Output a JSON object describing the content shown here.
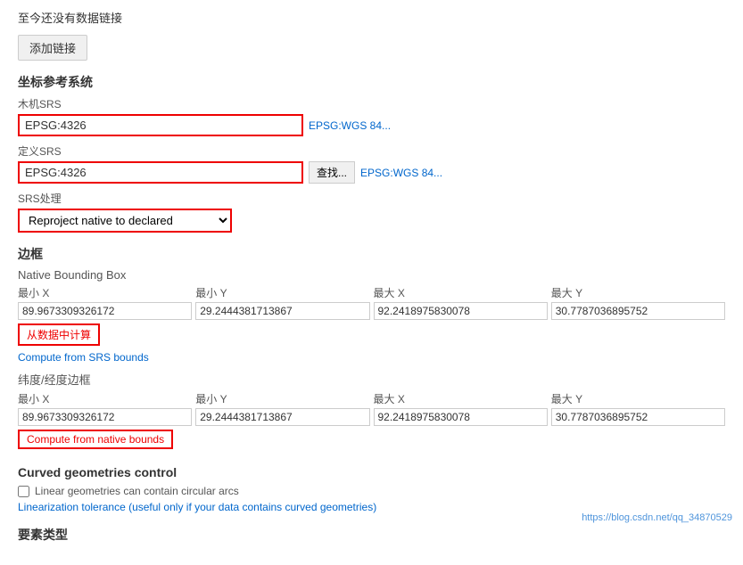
{
  "top": {
    "message": "至今还没有数据链接",
    "add_link_label": "添加链接"
  },
  "crs_section": {
    "title": "坐标参考系统",
    "native_srs_label": "木机SRS",
    "native_srs_value": "EPSG:4326",
    "native_srs_link": "EPSG:WGS 84...",
    "declared_srs_label": "定义SRS",
    "declared_srs_value": "EPSG:4326",
    "declared_srs_find": "查找...",
    "declared_srs_link": "EPSG:WGS 84...",
    "srs_handling_label": "SRS处理",
    "srs_handling_value": "Reproject native to declared ▼"
  },
  "bounding_box_section": {
    "title": "边框",
    "native_title": "Native Bounding Box",
    "col_labels": [
      "最小 X",
      "最小 Y",
      "最大 X",
      "最大 Y"
    ],
    "native_values": [
      "89.9673309326172",
      "29.2444381713867",
      "92.2418975830078",
      "30.7787036895752"
    ],
    "compute_native_btn": "从数据中计算",
    "compute_srs_link": "Compute from SRS bounds",
    "lat_lon_title": "纬度/经度边框",
    "lat_lon_values": [
      "89.9673309326172",
      "29.2444381713867",
      "92.2418975830078",
      "30.7787036895752"
    ],
    "compute_native_bounds_btn": "Compute from native bounds"
  },
  "curved_section": {
    "title": "Curved geometries control",
    "checkbox_label": "Linear geometries can contain circular arcs",
    "linearization_label": "Linearization tolerance (useful only if your data contains curved geometries)"
  },
  "feature_type_section": {
    "title": "要素类型"
  },
  "watermark": "https://blog.csdn.net/qq_34870529"
}
